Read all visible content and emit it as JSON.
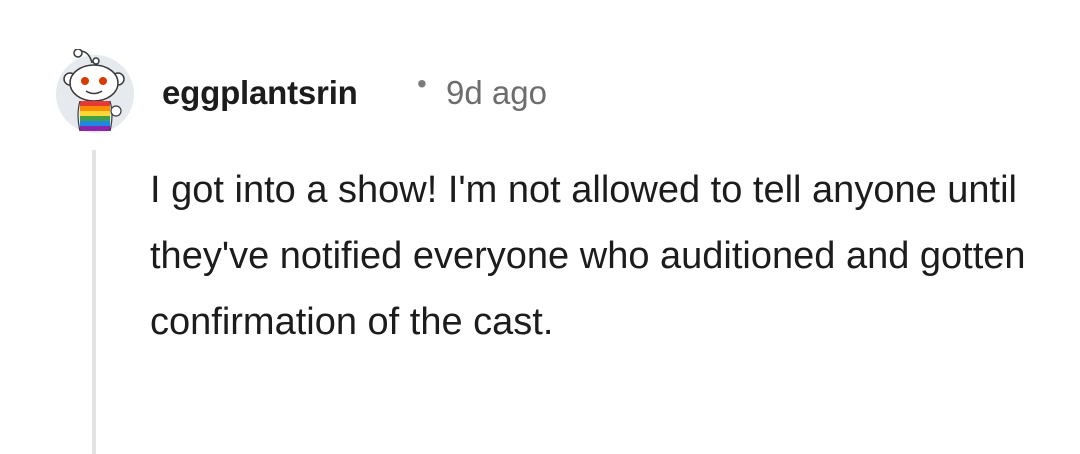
{
  "comment": {
    "author": "eggplantsrin",
    "separator": "•",
    "timestamp": "9d ago",
    "body": "I got into a show! I'm not allowed to tell anyone until they've notified everyone who auditioned and gotten confirmation of the cast."
  },
  "icons": {
    "avatar": "snoo-avatar-icon"
  },
  "colors": {
    "author": "#1c1c1c",
    "timestamp": "#6d6d6d",
    "thread_line": "#e3e3e3",
    "avatar_bg": "#e6eaee"
  }
}
